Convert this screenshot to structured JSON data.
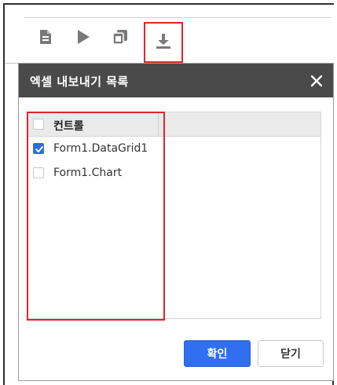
{
  "toolbar": {
    "icons": [
      {
        "name": "document-icon"
      },
      {
        "name": "play-icon"
      },
      {
        "name": "copy-icon"
      },
      {
        "name": "download-icon"
      }
    ]
  },
  "dialog": {
    "title": "엑셀 내보내기 목록",
    "list": {
      "header_label": "컨트롤",
      "rows": [
        {
          "label": "Form1.DataGrid1",
          "checked": true
        },
        {
          "label": "Form1.Chart",
          "checked": false
        }
      ]
    },
    "ok_label": "확인",
    "close_label": "닫기"
  },
  "colors": {
    "header_bg": "#4a4a4a",
    "highlight": "#e0242a",
    "primary": "#2f6ff0",
    "checkbox_checked": "#2b6fd6"
  }
}
